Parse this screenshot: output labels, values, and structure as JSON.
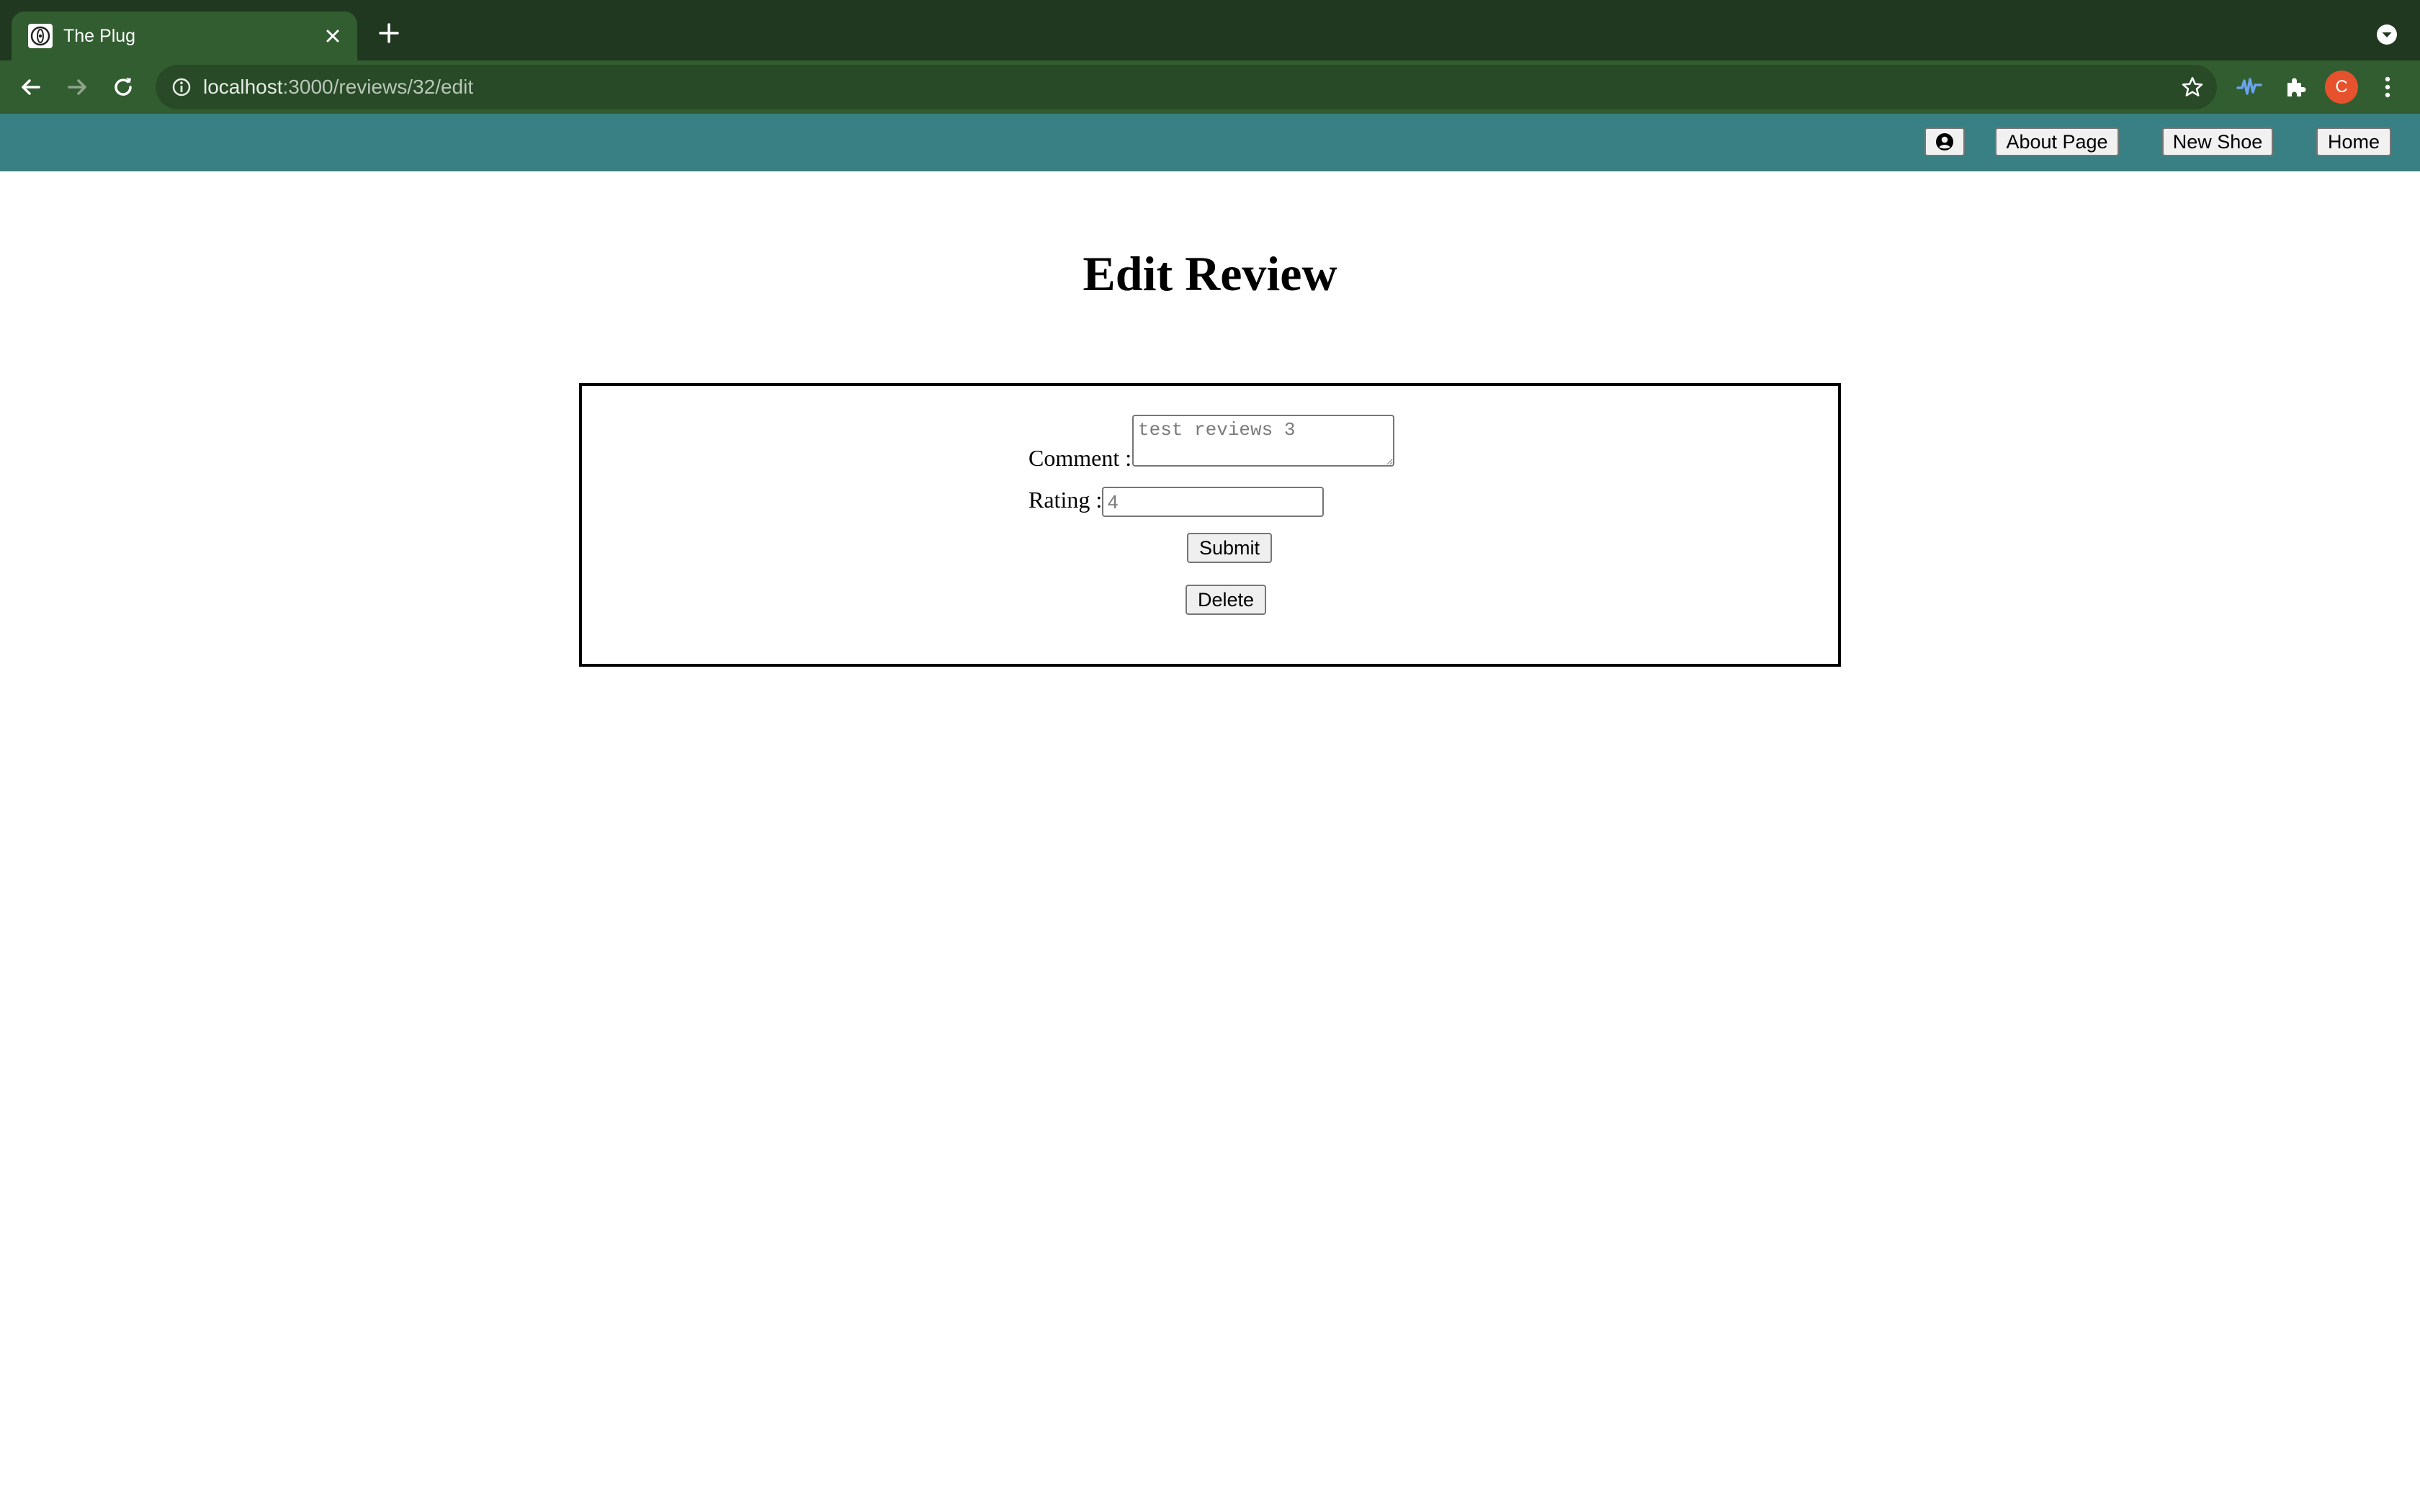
{
  "browser": {
    "tab": {
      "title": "The Plug",
      "favicon_icon": "react-logo-icon"
    },
    "address_bar": {
      "host": "localhost",
      "path": ":3000/reviews/32/edit"
    },
    "profile_initial": "C",
    "colors": {
      "tabstrip": "#213820",
      "toolbar": "#325d30",
      "omnibox": "#284a27",
      "profile": "#e5522d"
    }
  },
  "app_nav": {
    "background": "#388083",
    "profile_icon": "user-circle-icon",
    "about_label": "About Page",
    "new_shoe_label": "New Shoe",
    "home_label": "Home"
  },
  "page": {
    "title": "Edit Review"
  },
  "form": {
    "comment_label": "Comment :",
    "comment_placeholder": "test reviews 3",
    "rating_label": "Rating :",
    "rating_placeholder": "4",
    "submit_label": "Submit",
    "delete_label": "Delete"
  }
}
